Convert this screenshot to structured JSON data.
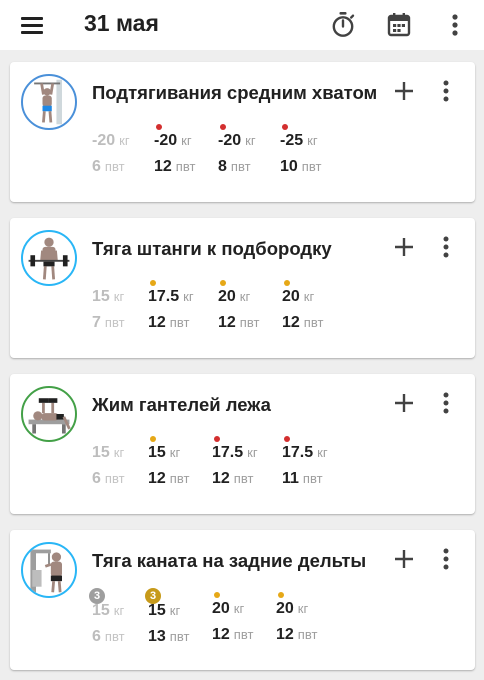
{
  "header": {
    "date": "31 мая",
    "icons": [
      "menu-icon",
      "stopwatch-icon",
      "calendar-icon",
      "more-vert-icon"
    ]
  },
  "colors": {
    "red": "#d32f2f",
    "amber": "#e6a817",
    "badge_gray": "#9e9e9e",
    "badge_gold": "#c79a1a",
    "avatar_blue": "#4a90d9",
    "avatar_green": "#43a047",
    "avatar_cyan": "#29b6f6"
  },
  "workouts": [
    {
      "name": "Подтягивания средним хватом",
      "avatar_icon": "pullup-icon",
      "ring": "#4a90d9",
      "sets": [
        {
          "weight": "-20",
          "wunit": "кг",
          "reps": "6",
          "runit": "пвт",
          "muted": true,
          "mark": "none"
        },
        {
          "weight": "-20",
          "wunit": "кг",
          "reps": "12",
          "runit": "пвт",
          "muted": false,
          "mark": "red"
        },
        {
          "weight": "-20",
          "wunit": "кг",
          "reps": "8",
          "runit": "пвт",
          "muted": false,
          "mark": "red"
        },
        {
          "weight": "-25",
          "wunit": "кг",
          "reps": "10",
          "runit": "пвт",
          "muted": false,
          "mark": "red"
        }
      ]
    },
    {
      "name": "Тяга штанги к подбородку",
      "avatar_icon": "barbell-row-icon",
      "ring": "#29b6f6",
      "sets": [
        {
          "weight": "15",
          "wunit": "кг",
          "reps": "7",
          "runit": "пвт",
          "muted": true,
          "mark": "none"
        },
        {
          "weight": "17.5",
          "wunit": "кг",
          "reps": "12",
          "runit": "пвт",
          "muted": false,
          "mark": "amber"
        },
        {
          "weight": "20",
          "wunit": "кг",
          "reps": "12",
          "runit": "пвт",
          "muted": false,
          "mark": "amber"
        },
        {
          "weight": "20",
          "wunit": "кг",
          "reps": "12",
          "runit": "пвт",
          "muted": false,
          "mark": "amber"
        }
      ]
    },
    {
      "name": "Жим гантелей лежа",
      "avatar_icon": "dumbbell-press-icon",
      "ring": "#43a047",
      "sets": [
        {
          "weight": "15",
          "wunit": "кг",
          "reps": "6",
          "runit": "пвт",
          "muted": true,
          "mark": "none"
        },
        {
          "weight": "15",
          "wunit": "кг",
          "reps": "12",
          "runit": "пвт",
          "muted": false,
          "mark": "amber"
        },
        {
          "weight": "17.5",
          "wunit": "кг",
          "reps": "12",
          "runit": "пвт",
          "muted": false,
          "mark": "red"
        },
        {
          "weight": "17.5",
          "wunit": "кг",
          "reps": "11",
          "runit": "пвт",
          "muted": false,
          "mark": "red"
        }
      ]
    },
    {
      "name": "Тяга каната на задние дельты",
      "avatar_icon": "cable-pull-icon",
      "ring": "#29b6f6",
      "sets": [
        {
          "weight": "15",
          "wunit": "кг",
          "reps": "6",
          "runit": "пвт",
          "muted": true,
          "mark": "badge",
          "badge": "3",
          "badge_color": "#9e9e9e"
        },
        {
          "weight": "15",
          "wunit": "кг",
          "reps": "13",
          "runit": "пвт",
          "muted": false,
          "mark": "badge",
          "badge": "3",
          "badge_color": "#c79a1a"
        },
        {
          "weight": "20",
          "wunit": "кг",
          "reps": "12",
          "runit": "пвт",
          "muted": false,
          "mark": "amber"
        },
        {
          "weight": "20",
          "wunit": "кг",
          "reps": "12",
          "runit": "пвт",
          "muted": false,
          "mark": "amber"
        }
      ]
    }
  ]
}
